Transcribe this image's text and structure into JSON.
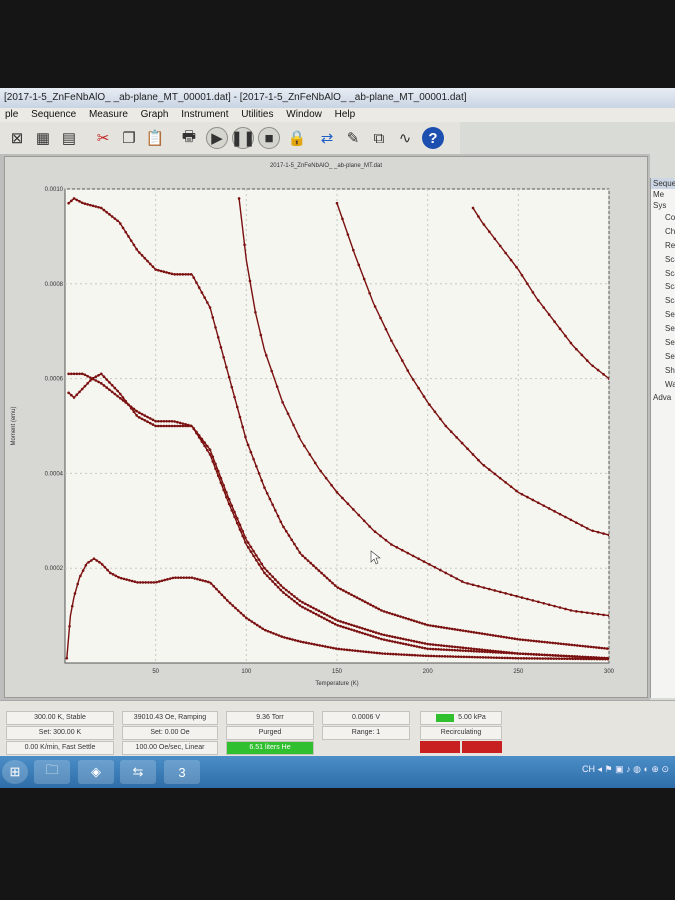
{
  "window": {
    "title": "[2017-1-5_ZnFeNbAlO_ _ab-plane_MT_00001.dat] - [2017-1-5_ZnFeNbAlO_ _ab-plane_MT_00001.dat]"
  },
  "menu": [
    "ple",
    "Sequence",
    "Measure",
    "Graph",
    "Instrument",
    "Utilities",
    "Window",
    "Help"
  ],
  "toolbar": {
    "icons": [
      "graph-icon",
      "table-icon",
      "data-grid-icon",
      "cut-icon",
      "copy-icon",
      "paste-icon",
      "print-icon",
      "play-icon",
      "pause-icon",
      "stop-icon",
      "lock-icon",
      "refresh-icon",
      "edit-icon",
      "instrument-icon",
      "wave-icon",
      "help-icon"
    ],
    "glyphs": [
      "⊠",
      "▦",
      "▤",
      "✂",
      "❐",
      "📋",
      "🖶",
      "▶",
      "❚❚",
      "■",
      "🔒",
      "⇄",
      "✎",
      "⧉",
      "∿",
      "?"
    ]
  },
  "graph": {
    "title": "2017-1-5_ZnFeNbAlO_ _ab-plane_MT.dat"
  },
  "sidebar": {
    "header": "Seque",
    "groups": [
      "Me",
      "Sys"
    ],
    "items": [
      "Co",
      "Ch",
      "Re",
      "Sca",
      "Sca",
      "Sca",
      "Sca",
      "Sea",
      "Set",
      "Set",
      "Set",
      "Shu",
      "Wai"
    ],
    "footer": "Adva"
  },
  "status": {
    "temp": [
      "300.00 K, Stable",
      "Set: 300.00 K",
      "0.00 K/min, Fast Settle"
    ],
    "field": [
      "39010.43 Oe, Ramping",
      "Set: 0.00 Oe",
      "100.00 Oe/sec, Linear"
    ],
    "chamber": [
      "9.36 Torr",
      "Purged",
      "6.51 liters He"
    ],
    "voltage": [
      "0.0006 V",
      "Range: 1"
    ],
    "pressure": [
      "5.00 kPa",
      "Recirculating"
    ]
  },
  "taskbar": {
    "items": [
      "start-icon",
      "folder-icon",
      "network-icon",
      "teamviewer-icon",
      "app-icon"
    ],
    "glyphs": [
      "⊞",
      "🗀",
      "◈",
      "⇆",
      "3"
    ],
    "tray": "CH ◂ ⚑ ▣ ♪ ◍ ◐ ⊕ ⊙"
  },
  "chart_data": {
    "type": "scatter",
    "title": "2017-1-5_ZnFeNbAlO_ _ab-plane_MT.dat",
    "xlabel": "Temperature (K)",
    "ylabel": "Moment (emu)",
    "xlim": [
      0,
      300
    ],
    "ylim": [
      0,
      0.001
    ],
    "xticks": [
      50,
      100,
      150,
      200,
      250,
      300
    ],
    "yticks": [
      0.0002,
      0.0004,
      0.0006,
      0.0008,
      0.001
    ],
    "xtick_labels": [
      "50",
      "100",
      "150",
      "200",
      "250",
      "300"
    ],
    "ytick_labels": [
      "0.0002",
      "0.0004",
      "0.0006",
      "0.0008",
      "0.0010"
    ],
    "grid": true,
    "color": "#7a1010",
    "series": [
      {
        "x": [
          2,
          5,
          10,
          20,
          30,
          40,
          50,
          60,
          70,
          80,
          90,
          100,
          110,
          120,
          130,
          150,
          175,
          200,
          250,
          300
        ],
        "y": [
          0.00097,
          0.00098,
          0.00097,
          0.00096,
          0.00093,
          0.00087,
          0.00083,
          0.00082,
          0.00082,
          0.00075,
          0.00061,
          0.00047,
          0.00037,
          0.00029,
          0.00023,
          0.00016,
          0.00011,
          8e-05,
          5e-05,
          3e-05
        ]
      },
      {
        "x": [
          2,
          5,
          10,
          15,
          20,
          30,
          40,
          50,
          60,
          70,
          80,
          90,
          100,
          110,
          120,
          130,
          150,
          175,
          200,
          250,
          300
        ],
        "y": [
          0.00057,
          0.00056,
          0.00058,
          0.0006,
          0.00061,
          0.00057,
          0.00052,
          0.0005,
          0.0005,
          0.0005,
          0.00044,
          0.00034,
          0.00025,
          0.00019,
          0.00015,
          0.00012,
          8e-05,
          5e-05,
          3e-05,
          2e-05,
          1e-05
        ]
      },
      {
        "x": [
          2,
          5,
          10,
          20,
          30,
          40,
          50,
          60,
          70,
          80,
          90,
          100,
          110,
          120,
          130,
          150,
          175,
          200,
          250,
          300
        ],
        "y": [
          0.00061,
          0.00061,
          0.00061,
          0.00059,
          0.00056,
          0.00053,
          0.00051,
          0.00051,
          0.0005,
          0.00045,
          0.00035,
          0.00026,
          0.0002,
          0.00016,
          0.00013,
          9e-05,
          6e-05,
          4e-05,
          2e-05,
          1e-05
        ]
      },
      {
        "x": [
          1,
          3,
          5,
          8,
          12,
          16,
          20,
          25,
          30,
          40,
          50,
          60,
          70,
          80,
          90,
          100,
          110,
          120,
          130,
          150,
          175,
          200,
          250,
          300
        ],
        "y": [
          1e-05,
          0.0001,
          0.00014,
          0.00018,
          0.00021,
          0.00022,
          0.00021,
          0.00019,
          0.00018,
          0.00017,
          0.00017,
          0.00018,
          0.00018,
          0.00017,
          0.00013,
          9.5e-05,
          7e-05,
          5.5e-05,
          4.5e-05,
          3e-05,
          2e-05,
          1.5e-05,
          1e-05,
          8e-06
        ]
      },
      {
        "x": [
          96,
          100,
          105,
          110,
          120,
          130,
          140,
          150,
          160,
          170,
          180,
          190,
          200,
          210,
          220,
          230,
          240,
          250,
          260,
          270,
          280,
          290,
          300
        ],
        "y": [
          0.00098,
          0.00085,
          0.00074,
          0.00066,
          0.00055,
          0.00047,
          0.00041,
          0.00036,
          0.00032,
          0.00028,
          0.00025,
          0.00023,
          0.00021,
          0.00019,
          0.00017,
          0.00016,
          0.00015,
          0.00014,
          0.00013,
          0.00012,
          0.00011,
          0.000105,
          0.0001
        ]
      },
      {
        "x": [
          150,
          160,
          170,
          180,
          190,
          200,
          210,
          220,
          230,
          240,
          250,
          260,
          270,
          280,
          290,
          300
        ],
        "y": [
          0.00097,
          0.00086,
          0.00076,
          0.00068,
          0.00061,
          0.00055,
          0.0005,
          0.00046,
          0.00042,
          0.00039,
          0.00036,
          0.00034,
          0.00032,
          0.0003,
          0.00028,
          0.00027
        ]
      },
      {
        "x": [
          225,
          230,
          240,
          250,
          260,
          270,
          280,
          290,
          300
        ],
        "y": [
          0.00096,
          0.00093,
          0.00088,
          0.00083,
          0.00077,
          0.00072,
          0.00067,
          0.00063,
          0.0006
        ]
      }
    ]
  }
}
